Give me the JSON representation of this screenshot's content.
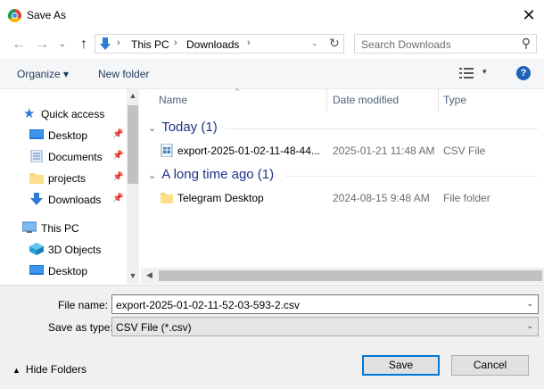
{
  "window": {
    "title": "Save As",
    "close_glyph": "✕"
  },
  "nav": {
    "back_glyph": "←",
    "forward_glyph": "→",
    "recent_glyph": "⌄",
    "up_glyph": "↑"
  },
  "address": {
    "crumbs": [
      "This PC",
      "Downloads"
    ],
    "separator": "›",
    "dropdown_glyph": "⌄",
    "refresh_glyph": "↻"
  },
  "search": {
    "placeholder": "Search Downloads",
    "icon_glyph": "⚲"
  },
  "toolbar": {
    "organize": "Organize ▾",
    "new_folder": "New folder",
    "view_dd": "▾",
    "help": "?"
  },
  "nav_pane": {
    "items": [
      {
        "label": "Quick access",
        "icon": "star-icon",
        "pinned": false
      },
      {
        "label": "Desktop",
        "icon": "desktop-icon",
        "pinned": true
      },
      {
        "label": "Documents",
        "icon": "documents-icon",
        "pinned": true
      },
      {
        "label": "projects",
        "icon": "folder-icon",
        "pinned": true
      },
      {
        "label": "Downloads",
        "icon": "downloads-icon",
        "pinned": true
      },
      {
        "label": "This PC",
        "icon": "computer-icon",
        "pinned": false
      },
      {
        "label": "3D Objects",
        "icon": "cube-icon",
        "pinned": false
      },
      {
        "label": "Desktop",
        "icon": "desktop-icon",
        "pinned": false
      }
    ],
    "pin_glyph": "📌"
  },
  "columns": {
    "name": "Name",
    "date": "Date modified",
    "type": "Type",
    "sort_glyph": "^"
  },
  "groups": [
    {
      "label": "Today (1)",
      "rows": [
        {
          "name": "export-2025-01-02-11-48-44...",
          "date": "2025-01-21 11:48 AM",
          "type": "CSV File",
          "icon": "csv-file-icon"
        }
      ]
    },
    {
      "label": "A long time ago (1)",
      "rows": [
        {
          "name": "Telegram Desktop",
          "date": "2024-08-15 9:48 AM",
          "type": "File folder",
          "icon": "folder-icon"
        }
      ]
    }
  ],
  "group_chevron": "⌄",
  "form": {
    "file_name_label": "File name:",
    "file_name_value": "export-2025-01-02-11-52-03-593-2.csv",
    "save_type_label": "Save as type:",
    "save_type_value": "CSV File (*.csv)",
    "dd_glyph": "⌄"
  },
  "footer": {
    "hide_folders": "Hide Folders",
    "hide_caret": "▲",
    "save": "Save",
    "cancel": "Cancel"
  },
  "scroll": {
    "up": "▲",
    "down": "▼",
    "left": "◀"
  },
  "colors": {
    "accent": "#0078d7",
    "group_text": "#1e3287",
    "help_blue": "#1c63b7"
  }
}
